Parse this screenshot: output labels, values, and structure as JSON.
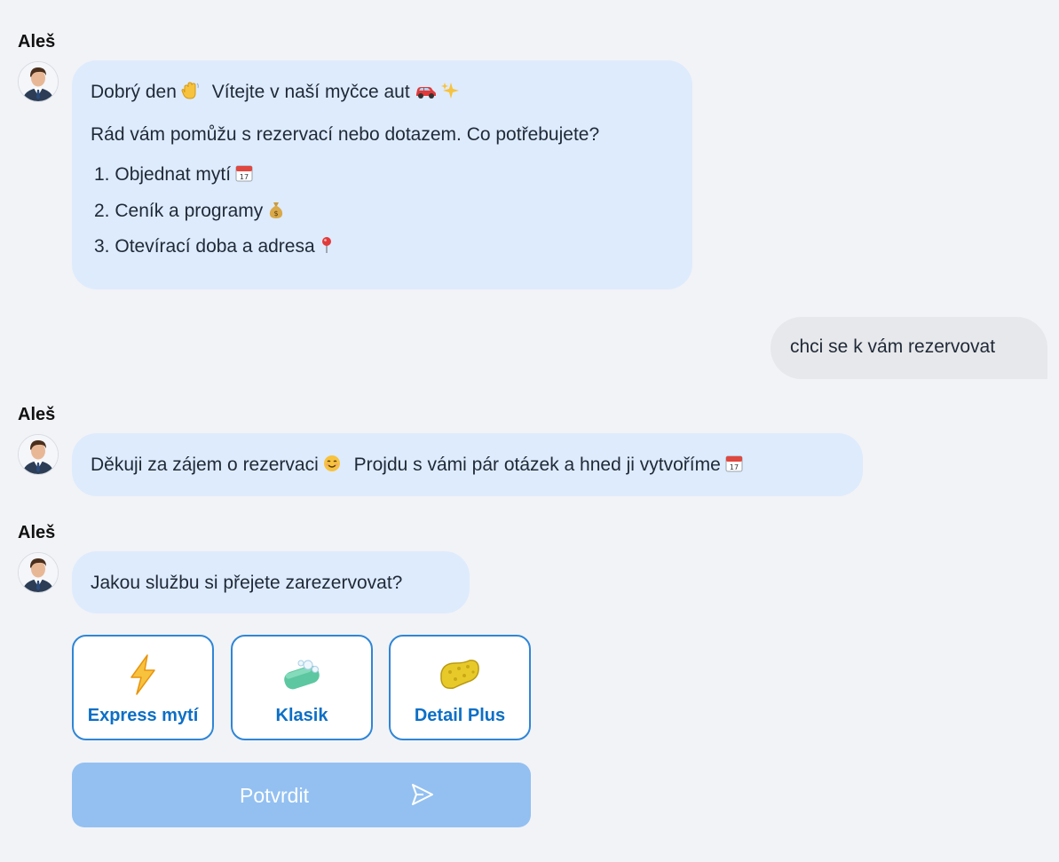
{
  "messages": [
    {
      "sender": "Aleš",
      "lines": [
        "Dobrý den",
        "Vítejte v naší myčce aut",
        "Rád vám pomůžu s rezervací nebo dotazem. Co potřebujete?"
      ],
      "list": [
        {
          "number": "1.",
          "text": "Objednat mytí"
        },
        {
          "number": "2.",
          "text": "Ceník a programy"
        },
        {
          "number": "3.",
          "text": "Otevírací doba a adresa"
        }
      ],
      "emoji": [
        "waving-hand",
        "car",
        "sparkles",
        "calendar",
        "money-bag",
        "round-pushpin"
      ]
    },
    {
      "sender": "user",
      "text": "chci se k vám rezervovat"
    },
    {
      "sender": "Aleš",
      "text_part1": "Děkuji za zájem o rezervaci",
      "text_part2": "Projdu s vámi pár otázek a hned ji vytvoříme",
      "emoji": [
        "smiling-face",
        "calendar"
      ]
    },
    {
      "sender": "Aleš",
      "text": "Jakou službu si přejete zarezervovat?"
    }
  ],
  "options": [
    {
      "label": "Express mytí",
      "icon": "lightning-icon"
    },
    {
      "label": "Klasik",
      "icon": "soap-icon"
    },
    {
      "label": "Detail Plus",
      "icon": "sponge-icon"
    }
  ],
  "confirm": {
    "label": "Potvrdit",
    "icon": "send-icon"
  },
  "colors": {
    "background": "#f2f3f7",
    "bot_bubble": "#deebfc",
    "user_bubble": "#e7e8eb",
    "option_border": "#2f86d6",
    "option_text": "#0c6fc6",
    "confirm_bg": "#93c0f1"
  }
}
